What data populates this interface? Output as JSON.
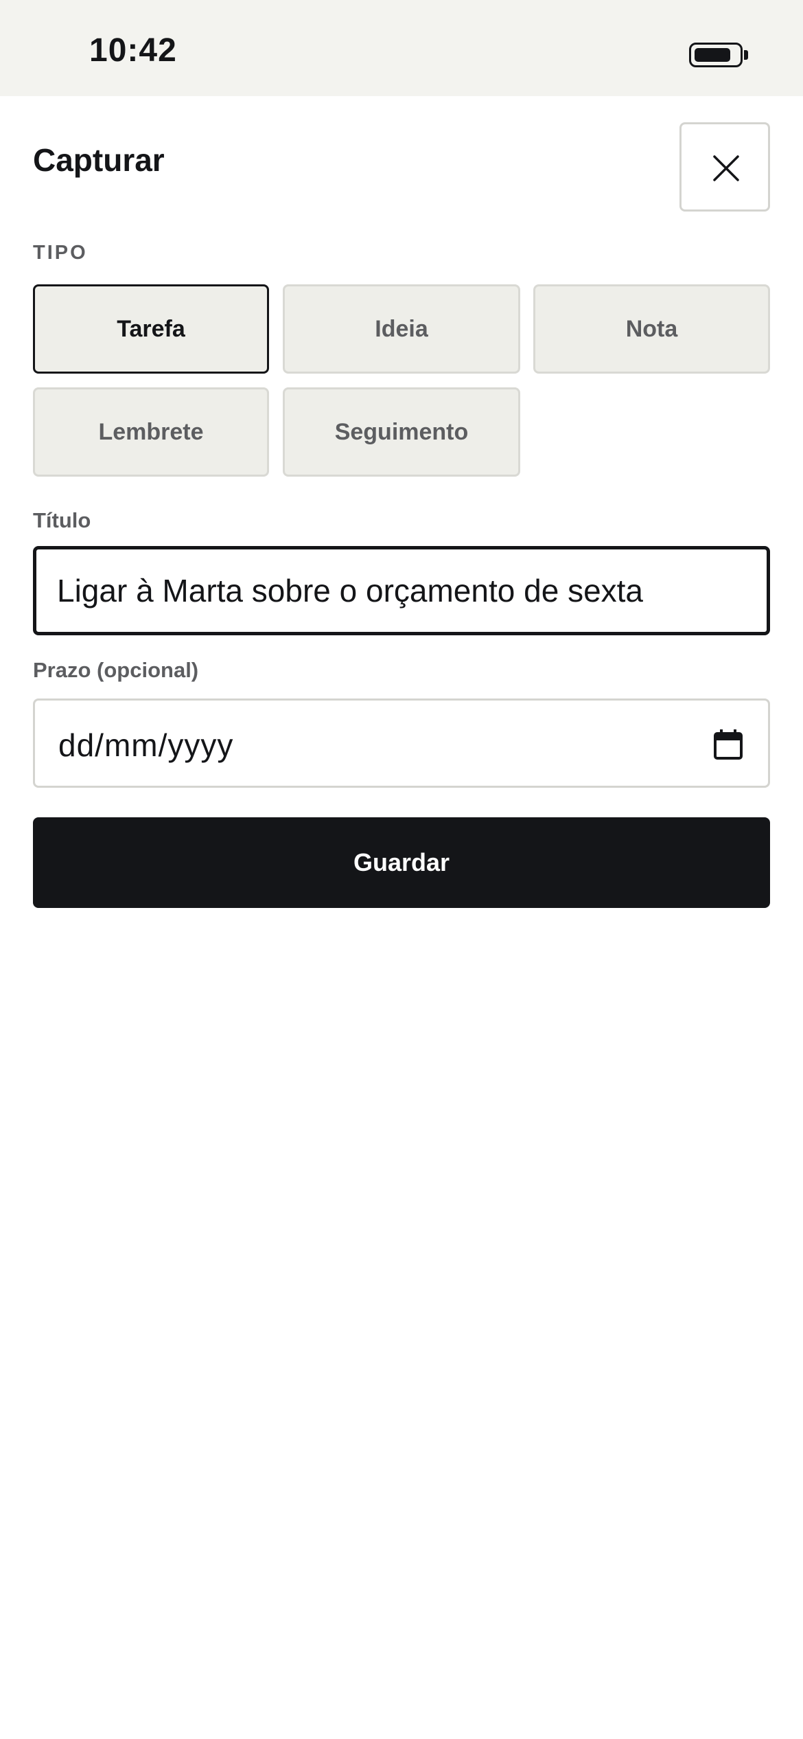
{
  "status_bar": {
    "time": "10:42",
    "battery_icon": "battery-icon"
  },
  "sheet": {
    "title": "Capturar",
    "close_icon": "close-icon"
  },
  "type_section": {
    "label": "TIPO",
    "selected": "Tarefa",
    "options": [
      {
        "label": "Tarefa",
        "selected": true
      },
      {
        "label": "Ideia",
        "selected": false
      },
      {
        "label": "Nota",
        "selected": false
      },
      {
        "label": "Lembrete",
        "selected": false
      },
      {
        "label": "Seguimento",
        "selected": false
      }
    ]
  },
  "title_field": {
    "label": "Título",
    "value": "Ligar à Marta sobre o orçamento de sexta"
  },
  "due_field": {
    "label": "Prazo (opcional)",
    "placeholder": "dd/mm/yyyy",
    "icon": "calendar-icon"
  },
  "actions": {
    "save_label": "Guardar"
  },
  "colors": {
    "primary": "#141518",
    "background": "#ffffff",
    "status_bar_bg": "#f3f3ef",
    "chip_bg": "#eeeee9",
    "chip_border": "#d9d9d4",
    "muted_text": "#5c5d60"
  }
}
